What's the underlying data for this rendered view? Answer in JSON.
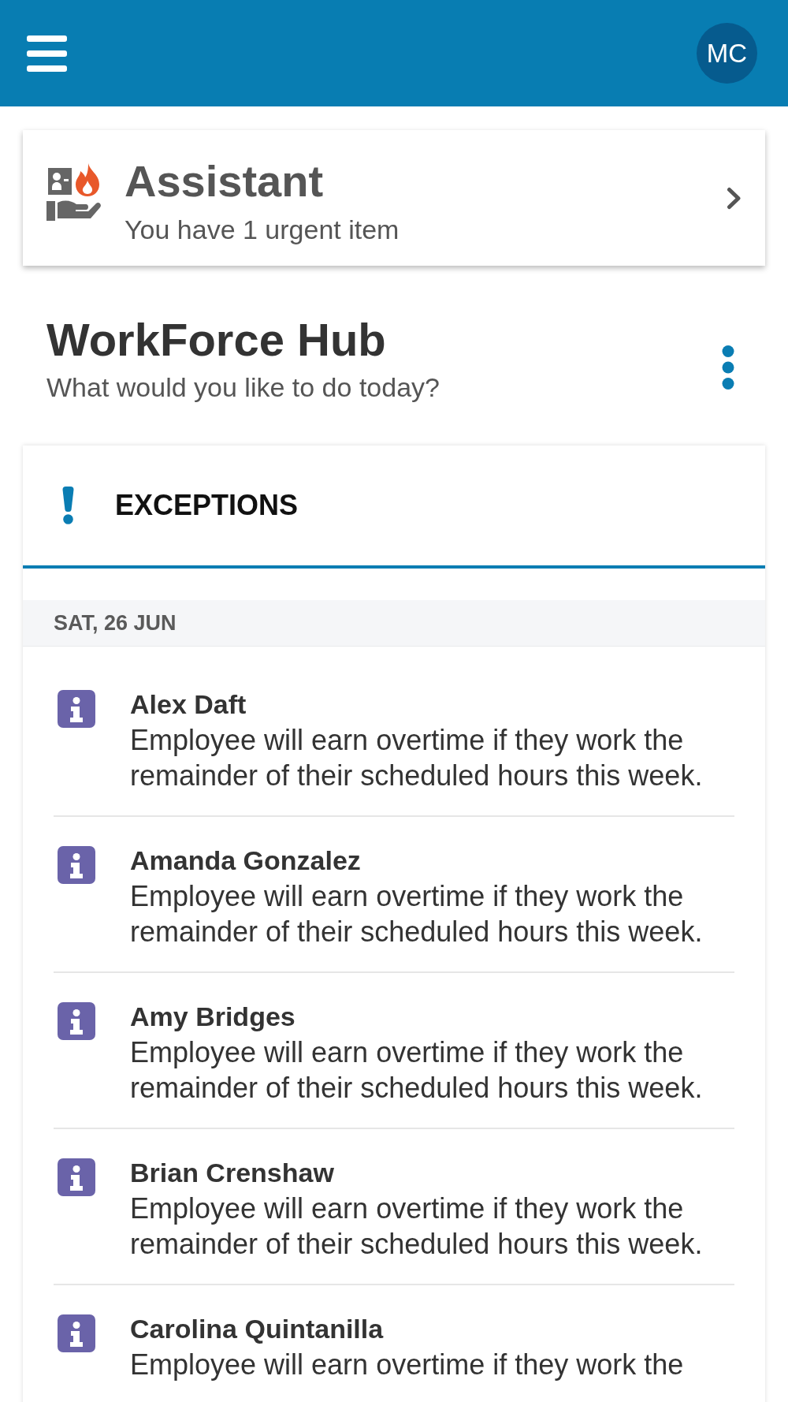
{
  "header": {
    "avatar": {
      "initials": "MC"
    }
  },
  "assistant": {
    "title": "Assistant",
    "subtitle": "You have 1 urgent item"
  },
  "hub": {
    "title": "WorkForce Hub",
    "subtitle": "What would you like to do today?"
  },
  "exceptions": {
    "title": "EXCEPTIONS",
    "groups": [
      {
        "date": "SAT, 26 JUN",
        "items": [
          {
            "name": "Alex Daft",
            "message": "Employee will earn overtime if they work the remainder of their scheduled hours this week."
          },
          {
            "name": "Amanda Gonzalez",
            "message": "Employee will earn overtime if they work the remainder of their scheduled hours this week."
          },
          {
            "name": "Amy Bridges",
            "message": "Employee will earn overtime if they work the remainder of their scheduled hours this week."
          },
          {
            "name": "Brian Crenshaw",
            "message": "Employee will earn overtime if they work the remainder of their scheduled hours this week."
          },
          {
            "name": "Carolina Quintanilla",
            "message": "Employee will earn overtime if they work the"
          }
        ]
      }
    ]
  }
}
